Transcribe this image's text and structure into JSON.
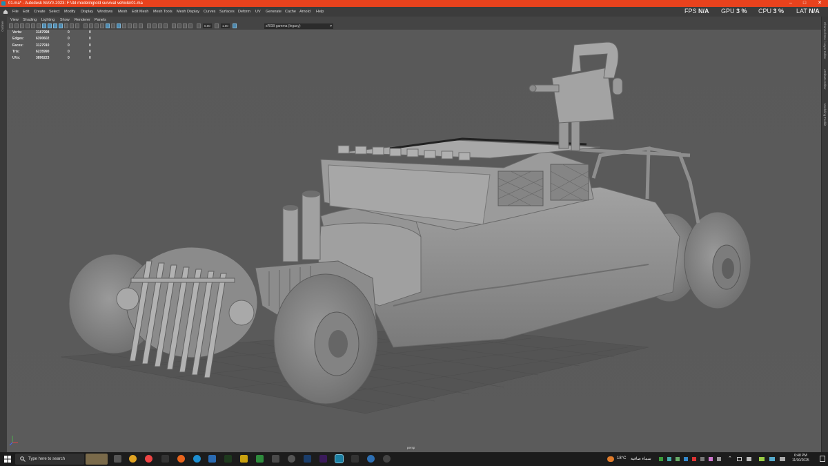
{
  "window": {
    "title": "01.ma* - Autodesk MAYA 2023: F:\\3d modeling\\old survival vehicle\\01.ma",
    "controls": [
      "–",
      "□",
      "✕"
    ]
  },
  "menu": [
    "File",
    "Edit",
    "Create",
    "Select",
    "Modify",
    "Display",
    "Windows",
    "Mesh",
    "Edit Mesh",
    "Mesh Tools",
    "Mesh Display",
    "Curves",
    "Surfaces",
    "Deform",
    "UV",
    "Generate",
    "Cache",
    "Arnold",
    "Help"
  ],
  "hud": {
    "fps_label": "FPS",
    "fps_value": "N/A",
    "gpu_label": "GPU",
    "gpu_value": "3 %",
    "cpu_label": "CPU",
    "cpu_value": "3 %",
    "lat_label": "LAT",
    "lat_value": "N/A"
  },
  "panel_menu": [
    "View",
    "Shading",
    "Lighting",
    "Show",
    "Renderer",
    "Panels"
  ],
  "toolbar": {
    "field1": "0.00",
    "field2": "1.00",
    "color_space": "sRGB gamma (legacy)"
  },
  "left_strip_label": "Outliner",
  "right_strip_labels": [
    "Channel Box / Layer Editor",
    "Attribute Editor",
    "Modeling Toolkit"
  ],
  "stats": [
    {
      "label": "Verts:",
      "value": "3187998",
      "sel": "0",
      "comp": "0"
    },
    {
      "label": "Edges:",
      "value": "6390602",
      "sel": "0",
      "comp": "0"
    },
    {
      "label": "Faces:",
      "value": "3127910",
      "sel": "0",
      "comp": "0"
    },
    {
      "label": "Tris:",
      "value": "6235990",
      "sel": "0",
      "comp": "0"
    },
    {
      "label": "UVs:",
      "value": "3896223",
      "sel": "0",
      "comp": "0"
    }
  ],
  "camera_label": "persp",
  "taskbar": {
    "search_placeholder": "Type here to search",
    "weather_temp": "18°C",
    "weather_desc": "سماء صافية",
    "time": "6:48 PM",
    "date": "11/30/2025"
  }
}
